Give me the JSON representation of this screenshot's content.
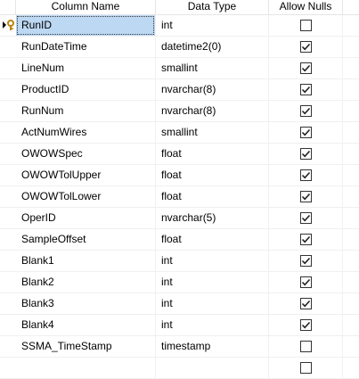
{
  "columns": {
    "name": "Column Name",
    "type": "Data Type",
    "nulls": "Allow Nulls"
  },
  "rows": [
    {
      "name": "RunID",
      "type": "int",
      "allow_nulls": false,
      "primary_key": true
    },
    {
      "name": "RunDateTime",
      "type": "datetime2(0)",
      "allow_nulls": true
    },
    {
      "name": "LineNum",
      "type": "smallint",
      "allow_nulls": true
    },
    {
      "name": "ProductID",
      "type": "nvarchar(8)",
      "allow_nulls": true
    },
    {
      "name": "RunNum",
      "type": "nvarchar(8)",
      "allow_nulls": true
    },
    {
      "name": "ActNumWires",
      "type": "smallint",
      "allow_nulls": true
    },
    {
      "name": "OWOWSpec",
      "type": "float",
      "allow_nulls": true
    },
    {
      "name": "OWOWTolUpper",
      "type": "float",
      "allow_nulls": true
    },
    {
      "name": "OWOWTolLower",
      "type": "float",
      "allow_nulls": true
    },
    {
      "name": "OperID",
      "type": "nvarchar(5)",
      "allow_nulls": true
    },
    {
      "name": "SampleOffset",
      "type": "float",
      "allow_nulls": true
    },
    {
      "name": "Blank1",
      "type": "int",
      "allow_nulls": true
    },
    {
      "name": "Blank2",
      "type": "int",
      "allow_nulls": true
    },
    {
      "name": "Blank3",
      "type": "int",
      "allow_nulls": true
    },
    {
      "name": "Blank4",
      "type": "int",
      "allow_nulls": true
    },
    {
      "name": "SSMA_TimeStamp",
      "type": "timestamp",
      "allow_nulls": false
    },
    {
      "name": "",
      "type": "",
      "allow_nulls": false
    }
  ],
  "icons": {
    "row_selector": "key-arrow-icon"
  },
  "colors": {
    "selection": "#bcd8f3",
    "gridline": "#f0f0f0",
    "key": "#d4a017"
  }
}
